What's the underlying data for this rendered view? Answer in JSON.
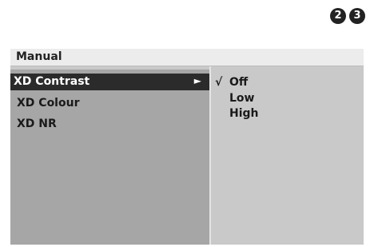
{
  "steps": [
    "2",
    "3"
  ],
  "panel": {
    "title": "Manual"
  },
  "menu": {
    "items": [
      {
        "label": "XD Contrast",
        "arrow": "►"
      },
      {
        "label": "XD Colour"
      },
      {
        "label": "XD NR"
      }
    ]
  },
  "options": {
    "check": "√",
    "items": [
      {
        "label": "Off"
      },
      {
        "label": "Low"
      },
      {
        "label": "High"
      }
    ]
  },
  "colors": {
    "panel_bg": "#c9c9c9",
    "left_pane_bg": "#a6a6a6",
    "title_bg": "#ececec",
    "selected_bg": "#2b2b2b",
    "step_badge": "#222222"
  }
}
